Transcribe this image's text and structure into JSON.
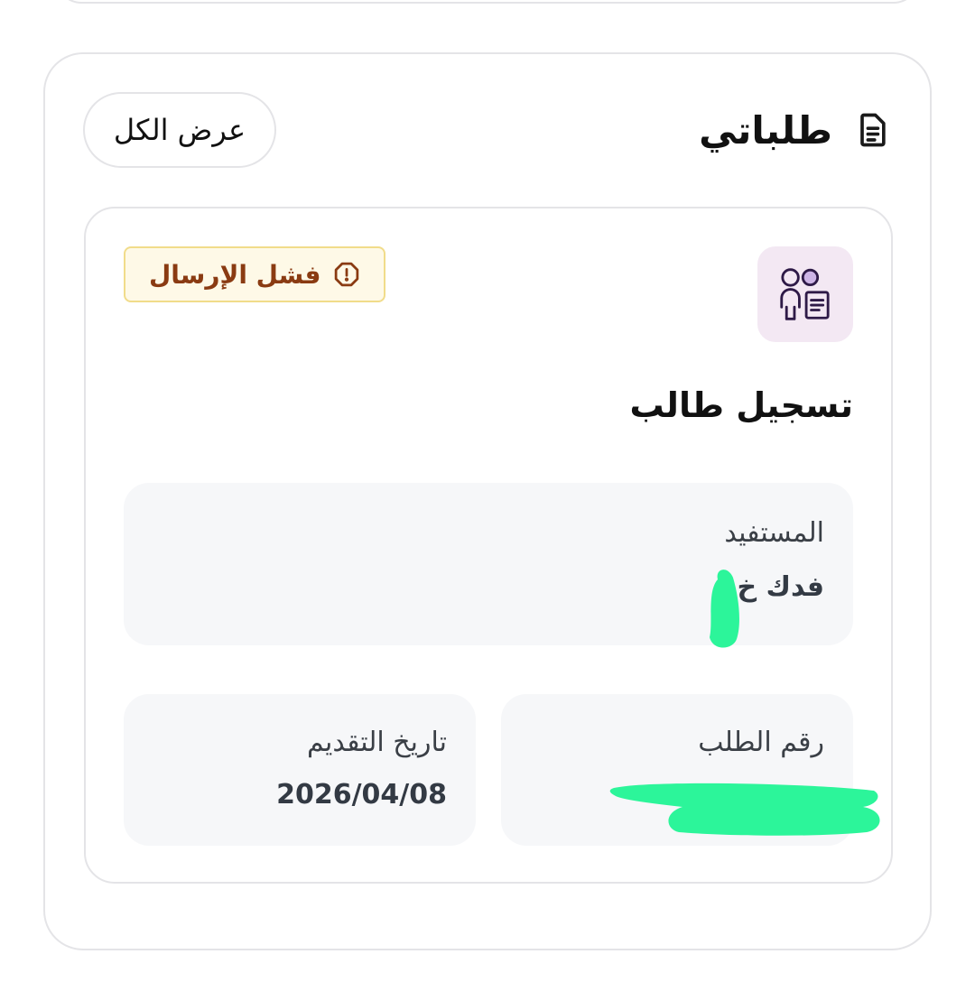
{
  "panel": {
    "title": "طلباتي",
    "view_all_label": "عرض الكل",
    "title_icon": "document-icon"
  },
  "request": {
    "type_icon": "student-registration-icon",
    "status": {
      "label": "فشل الإرسال",
      "icon": "warning-octagon-icon",
      "color": "#8a3b12",
      "background": "#fef9e7",
      "border": "#f1dc8a"
    },
    "title": "تسجيل طالب",
    "beneficiary": {
      "label": "المستفيد",
      "value": "فدك خ"
    },
    "request_number": {
      "label": "رقم الطلب",
      "value": "..."
    },
    "submission_date": {
      "label": "تاريخ التقديم",
      "value": "2026/04/08"
    }
  },
  "colors": {
    "icon_box": "#f3e8f3",
    "icon_stroke": "#2e1a47",
    "info_box": "#f6f7f9",
    "redaction": "#2cf59a"
  }
}
